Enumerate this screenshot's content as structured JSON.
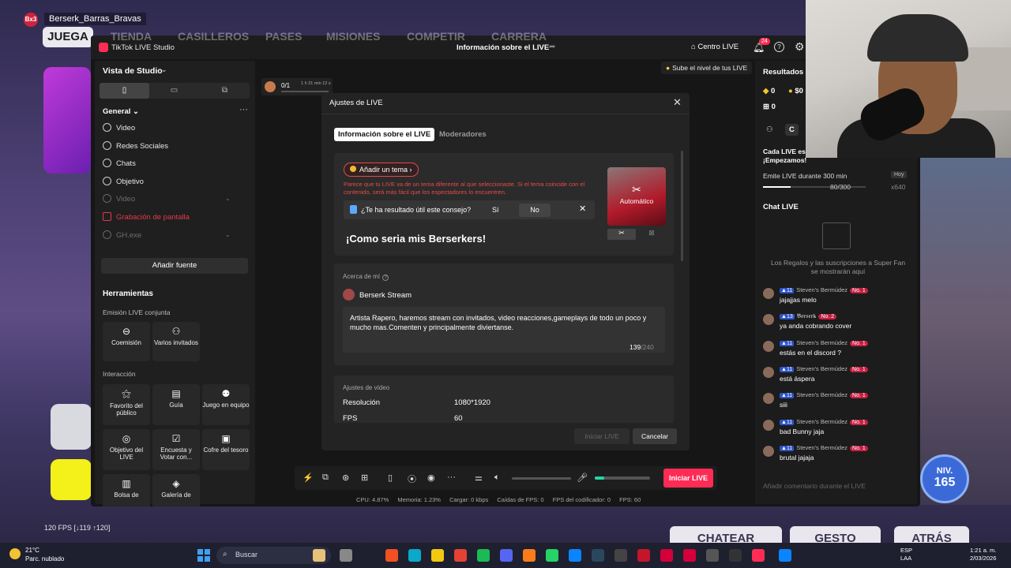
{
  "game": {
    "username": "Berserk_Barras_Bravas",
    "username_badge": "Bx3",
    "nav_active": "JUEGA",
    "nav_tabs": [
      "TIENDA",
      "CASILLEROS",
      "PASES",
      "MISIONES",
      "COMPETIR",
      "CARRERA"
    ],
    "fps_counter": "120 FPS [↓119 ↑120]",
    "buttons": {
      "chat": "CHATEAR",
      "gesture": "GESTO",
      "back": "ATRÁS"
    },
    "level_label": "NIV.",
    "level_value": "165"
  },
  "studio": {
    "app_title": "TikTok LIVE Studio",
    "window_title": "Información sobre el LIVE",
    "centro_live": "Centro LIVE",
    "notifications_count": "24",
    "level_up_hint": "Sube el nivel de tus LIVE",
    "left_panel": {
      "view_label": "Vista de Studio",
      "general_label": "General",
      "sources": [
        {
          "label": "Video",
          "state": "normal"
        },
        {
          "label": "Redes Sociales",
          "state": "normal"
        },
        {
          "label": "Chats",
          "state": "normal"
        },
        {
          "label": "Objetivo",
          "state": "normal"
        },
        {
          "label": "Video",
          "state": "dim"
        },
        {
          "label": "Grabación de pantalla",
          "state": "red"
        },
        {
          "label": "GH.exe",
          "state": "dim"
        }
      ],
      "add_source": "Añadir fuente",
      "tools_title": "Herramientas",
      "joint_live_label": "Emisión LIVE conjunta",
      "tools_joint": [
        {
          "label": "Coemisión",
          "icon": "link-icon"
        },
        {
          "label": "Varios invitados",
          "icon": "users-icon"
        }
      ],
      "interaction_label": "Interacción",
      "tools_interaction": [
        {
          "label": "Favorito del público",
          "icon": "star-user-icon"
        },
        {
          "label": "Guía",
          "icon": "guide-icon"
        },
        {
          "label": "Juego en equipo",
          "icon": "team-icon"
        },
        {
          "label": "Objetivo del LIVE",
          "icon": "target-icon"
        },
        {
          "label": "Encuesta y Votar con...",
          "icon": "poll-icon"
        },
        {
          "label": "Cofre del tesoro",
          "icon": "chest-icon"
        },
        {
          "label": "Bolsa de",
          "icon": "bag-icon"
        },
        {
          "label": "Galería de",
          "icon": "gallery-icon"
        }
      ]
    },
    "preview_chip": {
      "count": "0/1",
      "time": "1 h 31 min 12 s"
    },
    "toolbar": {
      "go_live": "Iniciar LIVE"
    },
    "status": {
      "cpu": "CPU: 4.87%",
      "memory": "Memoria: 1.23%",
      "upload": "Cargar: 0 kbps",
      "fps_drops": "Caídas de FPS: 0",
      "encoder_fps": "FPS del codificador: 0",
      "fps": "FPS: 60"
    },
    "right_panel": {
      "results_title": "Resultados d",
      "stat_1": "0",
      "stat_2": "$0",
      "stat_3": "0",
      "tab_label": "C",
      "goal_title": "Cada LIVE es ¡Empezamos!",
      "goal_desc": "Emite LIVE durante 300 min",
      "goal_badge": "Hoy",
      "goal_progress": "80/300",
      "goal_progress_fraction": 0.27,
      "goal_reward": "x640",
      "chat_title": "Chat LIVE",
      "gifts_empty": "Los Regalos y las suscripciones a Super Fan se mostrarán aquí",
      "messages": [
        {
          "level": "11",
          "user": "Steven's Bermúdez",
          "badge": "No. 1",
          "text": "jajajjas melo"
        },
        {
          "level": "13",
          "user": "𝕭𝖊𝖗𝖘𝖊𝖗𝖐",
          "badge": "No. 2",
          "text": "ya anda cobrando cover"
        },
        {
          "level": "11",
          "user": "Steven's Bermúdez",
          "badge": "No. 1",
          "text": "estás en el discord ?"
        },
        {
          "level": "11",
          "user": "Steven's Bermúdez",
          "badge": "No. 1",
          "text": "está áspera"
        },
        {
          "level": "11",
          "user": "Steven's Bermúdez",
          "badge": "No. 1",
          "text": "siii"
        },
        {
          "level": "11",
          "user": "Steven's Bermúdez",
          "badge": "No. 1",
          "text": "bad Bunny jaja"
        },
        {
          "level": "11",
          "user": "Steven's Bermúdez",
          "badge": "No. 1",
          "text": "brutal jajaja"
        }
      ],
      "chat_placeholder": "Añadir comentario durante el LIVE"
    }
  },
  "modal": {
    "title": "Ajustes de LIVE",
    "tab_info": "Información sobre el LIVE",
    "tab_mods": "Moderadores",
    "add_theme": "Añadir un tema",
    "warning": "Parece que tu LIVE va de un tema diferente al que seleccionaste. Si el tema coincide con el contenido, será más fácil que los espectadores lo encuentren.",
    "tip_question": "¿Te ha resultado útil este consejo?",
    "tip_yes": "Sí",
    "tip_no": "No",
    "live_title": "¡Como seria mis Berserkers!",
    "cover_label": "Automático",
    "about_label": "Acerca de mí",
    "profile_name": "Berserk Stream",
    "bio": "Artista Rapero, haremos stream con invitados, video reacciones,gameplays de todo un poco y mucho mas.Comenten y principalmente diviertanse.",
    "bio_count": "139",
    "bio_max": "/240",
    "video_settings": "Ajustes de vídeo",
    "resolution_label": "Resolución",
    "resolution_value": "1080*1920",
    "fps_label": "FPS",
    "fps_value": "60",
    "btn_start": "Iniciar LIVE",
    "btn_cancel": "Cancelar"
  },
  "taskbar": {
    "temp": "21°C",
    "weather": "Parc. nublado",
    "search": "Buscar",
    "lang": "ESP",
    "lang2": "LAA",
    "time": "1:21 a. m.",
    "date": "2/03/2026"
  }
}
